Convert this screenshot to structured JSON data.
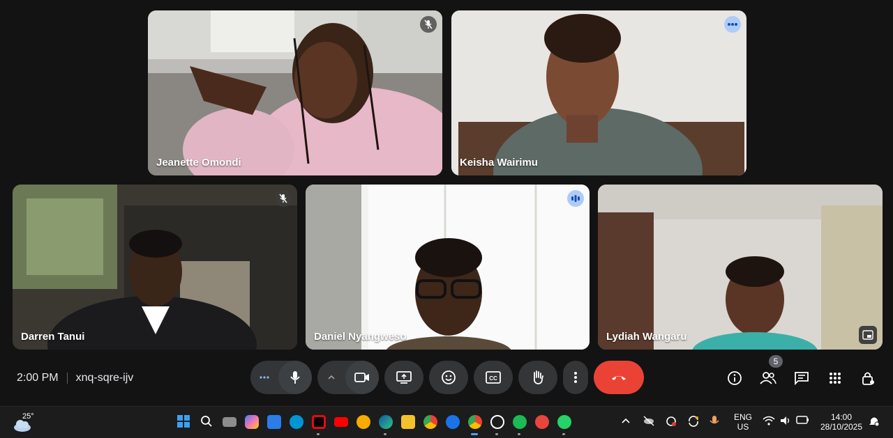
{
  "meeting": {
    "time": "2:00 PM",
    "code": "xnq-sqre-ijv",
    "participant_count": "5"
  },
  "participants": [
    {
      "name": "Jeanette Omondi",
      "status": "muted"
    },
    {
      "name": "Keisha Wairimu",
      "status": "more-options"
    },
    {
      "name": "Darren Tanui",
      "status": "muted"
    },
    {
      "name": "Daniel Nyangweso",
      "status": "speaking"
    },
    {
      "name": "Lydiah Wangaru",
      "status": "pip"
    }
  ],
  "controls": {
    "more_options_icon": "ellipsis-icon",
    "mic_icon": "mic-icon",
    "expand_icon": "chevron-up-icon",
    "camera_icon": "camera-icon",
    "present_icon": "present-screen-icon",
    "reactions_icon": "emoji-icon",
    "captions_icon": "captions-icon",
    "raise_hand_icon": "hand-icon",
    "overflow_icon": "vertical-dots-icon",
    "end_call_icon": "phone-hangup-icon",
    "end_call_color": "#ea4335"
  },
  "right_controls": [
    "info-icon",
    "people-icon",
    "chat-icon",
    "apps-icon",
    "host-controls-icon"
  ],
  "taskbar": {
    "weather_temp": "25°",
    "language_line1": "ENG",
    "language_line2": "US",
    "clock_time": "14:00",
    "clock_date": "28/10/2025"
  }
}
